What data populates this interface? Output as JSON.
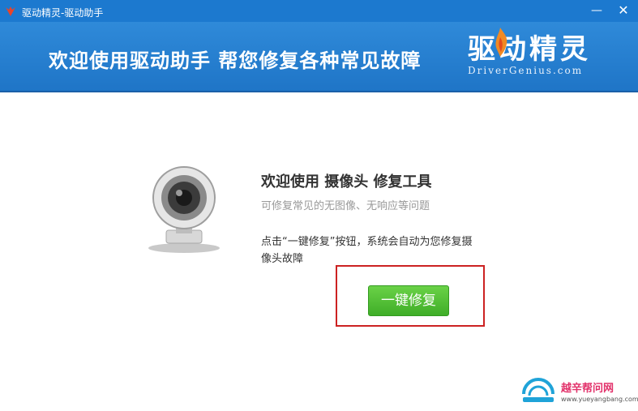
{
  "window": {
    "title": "驱动精灵-驱动助手",
    "minimize_glyph": "—",
    "close_glyph": "✕"
  },
  "banner": {
    "text": "欢迎使用驱动助手  帮您修复各种常见故障",
    "logo_cn": "驱动精灵",
    "logo_en": "DriverGenius.com"
  },
  "main": {
    "heading": "欢迎使用 摄像头 修复工具",
    "subheading": "可修复常见的无图像、无响应等问题",
    "description": "点击“一键修复”按钮，系统会自动为您修复摄像头故障",
    "repair_button": "一键修复"
  },
  "watermark": {
    "text": "越辛帮问网",
    "url": "www.yueyangbang.com"
  },
  "colors": {
    "titlebar": "#1c79cf",
    "banner": "#2a84d6",
    "button_green": "#4cbf33",
    "highlight_red": "#cc2222"
  },
  "icons": [
    "app-flame-icon",
    "minimize-icon",
    "close-icon",
    "webcam-icon",
    "watermark-logo-icon"
  ]
}
